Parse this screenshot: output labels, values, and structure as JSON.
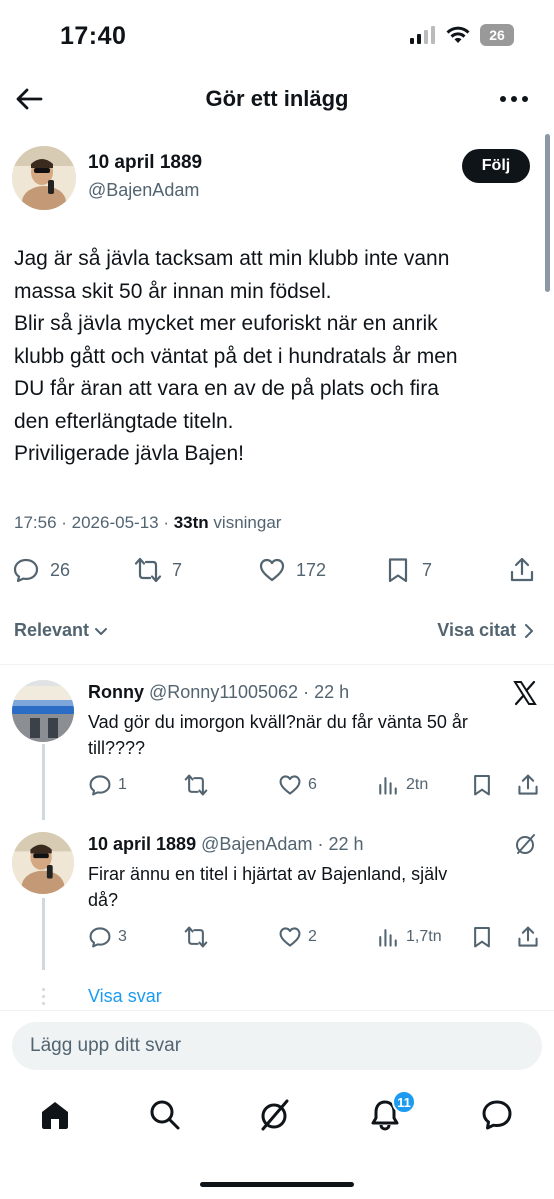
{
  "status": {
    "time": "17:40",
    "battery": "26"
  },
  "nav": {
    "title": "Gör ett inlägg"
  },
  "post": {
    "author_name": "10 april 1889",
    "author_handle": "@BajenAdam",
    "follow_label": "Följ",
    "lines": [
      "Jag är så jävla tacksam att min klubb inte vann",
      "massa skit 50 år innan min födsel.",
      "Blir så jävla mycket mer euforiskt när en anrik",
      "klubb gått och väntat på det i hundratals år men",
      "DU får äran att vara en av de på plats och fira",
      "den efterlängtade titeln.",
      "Priviligerade jävla Bajen!"
    ],
    "timestamp": "17:56 · 2026-05-13 · ",
    "views_count": "33tn",
    "views_label": " visningar",
    "replies": "26",
    "reposts": "7",
    "likes": "172",
    "bookmarks": "7"
  },
  "filter": {
    "sort_label": "Relevant",
    "quotes_label": "Visa citat"
  },
  "replies": [
    {
      "name": "Ronny",
      "handle": "@Ronny11005062",
      "time": " · 22 h",
      "text_line1": "Vad gör du imorgon kväll?när du får vänta 50 år",
      "text_line2": "till????",
      "replies": "1",
      "reposts": "",
      "likes": "6",
      "views": "2tn"
    },
    {
      "name": "10 april 1889",
      "handle": "@BajenAdam",
      "time": " · 22 h",
      "text_line1": "Firar ännu en titel i hjärtat av Bajenland, själv",
      "text_line2": "då?",
      "replies": "3",
      "reposts": "",
      "likes": "2",
      "views": "1,7tn"
    }
  ],
  "show_replies": "Visa svar",
  "composer": {
    "placeholder": "Lägg upp ditt svar"
  },
  "tabbar": {
    "notifications_badge": "11"
  },
  "colors": {
    "accent": "#1d9bf0",
    "text": "#0f1419",
    "muted": "#536471"
  }
}
